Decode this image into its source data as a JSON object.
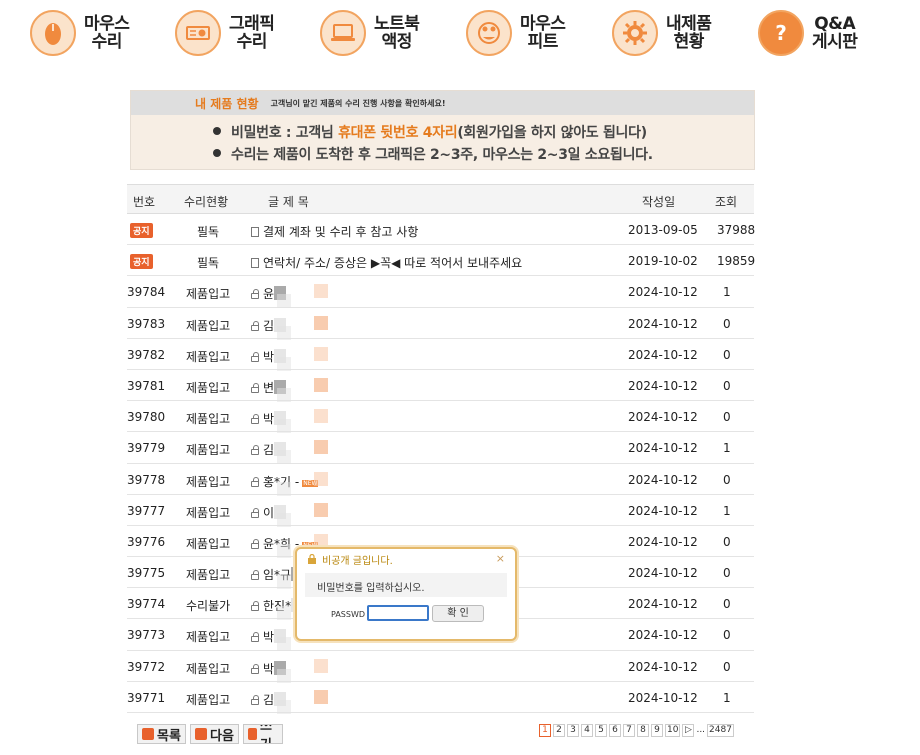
{
  "nav": [
    {
      "label": "마우스\n수리",
      "icon": "mouse-icon"
    },
    {
      "label": "그래픽\n수리",
      "icon": "graphics-card-icon"
    },
    {
      "label": "노트북\n액정",
      "icon": "laptop-icon"
    },
    {
      "label": "마우스\n피트",
      "icon": "mouse-feet-icon"
    },
    {
      "label": "내제품\n현황",
      "icon": "gear-icon"
    },
    {
      "label": "Q&A\n게시판",
      "icon": "question-icon"
    }
  ],
  "banner": {
    "title": "내 제품 현황",
    "subtitle": "고객님이 맡긴 제품의 수리 진행 사항을 확인하세요!",
    "line1_pre": "비밀번호 : 고객님 ",
    "line1_hl": "휴대폰 뒷번호 4자리",
    "line1_post": "(회원가입을 하지 않아도 됩니다)",
    "line2": "수리는 제품이 도착한 후 그래픽은 2~3주, 마우스는 2~3일 소요됩니다."
  },
  "table": {
    "headers": {
      "num": "번호",
      "status": "수리현황",
      "title": "글 제 목",
      "date": "작성일",
      "views": "조회"
    },
    "notices": [
      {
        "badge": "공지",
        "status": "필독",
        "title": "결제 계좌 및 수리 후 참고 사항",
        "date": "2013-09-05",
        "views": "37988"
      },
      {
        "badge": "공지",
        "status": "필독",
        "title": "연락처/ 주소/ 증상은 ▶꼭◀ 따로 적어서 보내주세요",
        "date": "2019-10-02",
        "views": "19859"
      }
    ],
    "rows": [
      {
        "num": "39784",
        "status": "제품입고",
        "title": "윤",
        "date": "2024-10-12",
        "views": "1"
      },
      {
        "num": "39783",
        "status": "제품입고",
        "title": "김",
        "date": "2024-10-12",
        "views": "0"
      },
      {
        "num": "39782",
        "status": "제품입고",
        "title": "박",
        "date": "2024-10-12",
        "views": "0"
      },
      {
        "num": "39781",
        "status": "제품입고",
        "title": "변",
        "date": "2024-10-12",
        "views": "0"
      },
      {
        "num": "39780",
        "status": "제품입고",
        "title": "박",
        "date": "2024-10-12",
        "views": "0"
      },
      {
        "num": "39779",
        "status": "제품입고",
        "title": "김",
        "date": "2024-10-12",
        "views": "1"
      },
      {
        "num": "39778",
        "status": "제품입고",
        "title": "홍*기 -",
        "date": "2024-10-12",
        "views": "0",
        "new": "NEW"
      },
      {
        "num": "39777",
        "status": "제품입고",
        "title": "이",
        "date": "2024-10-12",
        "views": "1"
      },
      {
        "num": "39776",
        "status": "제품입고",
        "title": "윤*희 -",
        "date": "2024-10-12",
        "views": "0",
        "new": "NEW"
      },
      {
        "num": "39775",
        "status": "제품입고",
        "title": "임*규",
        "date": "2024-10-12",
        "views": "0"
      },
      {
        "num": "39774",
        "status": "수리불가",
        "title": "한진*",
        "date": "2024-10-12",
        "views": "0"
      },
      {
        "num": "39773",
        "status": "제품입고",
        "title": "박",
        "date": "2024-10-12",
        "views": "0"
      },
      {
        "num": "39772",
        "status": "제품입고",
        "title": "박",
        "date": "2024-10-12",
        "views": "0"
      },
      {
        "num": "39771",
        "status": "제품입고",
        "title": "김",
        "date": "2024-10-12",
        "views": "1"
      }
    ]
  },
  "buttons": {
    "list": "목록",
    "next": "다음",
    "write": "쓰기"
  },
  "pagination": {
    "pages": [
      "1",
      "2",
      "3",
      "4",
      "5",
      "6",
      "7",
      "8",
      "9",
      "10"
    ],
    "active": "1",
    "next": "▷",
    "ellipsis": "...",
    "last": "2487"
  },
  "modal": {
    "title": "비공개 글입니다.",
    "close": "×",
    "message": "비밀번호를 입력하십시오.",
    "pw_label": "PASSWD",
    "input_value": "",
    "confirm": "확 인"
  },
  "colors": {
    "accent": "#e8612c",
    "highlight": "#e57b1e",
    "modal_border": "#e4b96a"
  }
}
